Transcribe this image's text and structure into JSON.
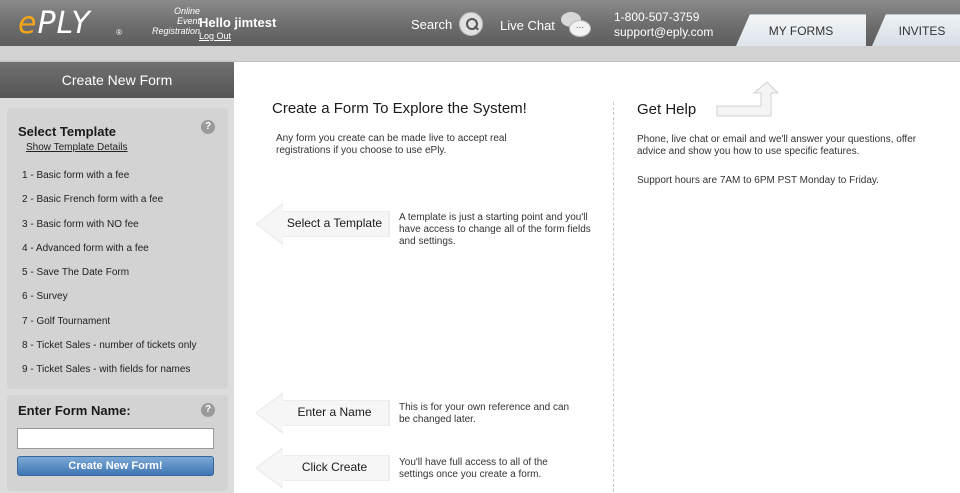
{
  "header": {
    "logo_text_e": "e",
    "logo_text_ply": "PLY",
    "logo_registered": "®",
    "logo_tagline": [
      "Online",
      "Event",
      "Registration"
    ],
    "greeting": "Hello jimtest",
    "logout": "Log Out",
    "search": "Search",
    "live_chat": "Live Chat",
    "chat_glyph": "...",
    "phone": "1-800-507-3759",
    "email": "support@eply.com",
    "tabs": [
      {
        "label": "MY FORMS"
      },
      {
        "label": "INVITES"
      }
    ]
  },
  "sidebar": {
    "title": "Create New Form",
    "template_section": {
      "title": "Select Template",
      "help": "?",
      "show_details": "Show Template Details",
      "templates": [
        "1 - Basic form with a fee",
        "2 - Basic French form with a fee",
        "3 - Basic form with NO fee",
        "4 - Advanced form with a fee",
        "5 - Save The Date Form",
        "6 - Survey",
        "7 - Golf Tournament",
        "8 - Ticket Sales - number of tickets only",
        "9 - Ticket Sales - with fields for names"
      ]
    },
    "name_section": {
      "title": "Enter Form Name:",
      "help": "?",
      "input_value": "",
      "button": "Create New Form!"
    }
  },
  "main": {
    "explore": {
      "title": "Create a Form To Explore the System!",
      "text": "Any form you create can be made live to accept real registrations if you choose to use ePly."
    },
    "steps": [
      {
        "label": "Select a Template",
        "desc": "A template is just a starting point and you'll have access to change all of the form fields and settings."
      },
      {
        "label": "Enter a Name",
        "desc": "This is for your own reference and can be changed later."
      },
      {
        "label": "Click Create",
        "desc": "You'll have full access to all of the settings once you create a form."
      }
    ],
    "help": {
      "title": "Get Help",
      "text": "Phone, live chat or email and we'll answer your questions, offer advice and show you how to use specific features.",
      "hours": "Support hours are 7AM to 6PM PST Monday to Friday."
    }
  },
  "colors": {
    "logo_orange": "#f4a51c",
    "header_gray": "#6b6b6b",
    "button_blue": "#3f76b3"
  }
}
